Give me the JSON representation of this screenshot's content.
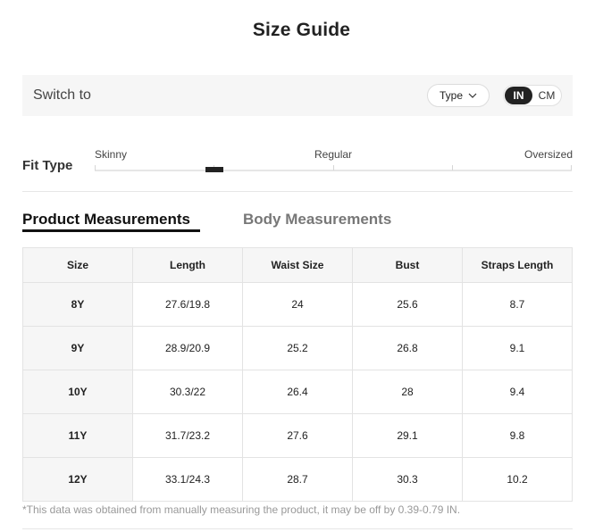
{
  "page": {
    "title": "Size Guide"
  },
  "switch_bar": {
    "label": "Switch to",
    "type_button": "Type",
    "units": {
      "active": "IN",
      "inactive": "CM"
    }
  },
  "fit_type": {
    "label": "Fit Type",
    "options": [
      "Skinny",
      "Regular",
      "Oversized"
    ],
    "selected_position": 0.25
  },
  "tabs": {
    "active": "Product Measurements",
    "inactive": "Body Measurements"
  },
  "table": {
    "headers": [
      "Size",
      "Length",
      "Waist Size",
      "Bust",
      "Straps Length"
    ],
    "rows": [
      [
        "8Y",
        "27.6/19.8",
        "24",
        "25.6",
        "8.7"
      ],
      [
        "9Y",
        "28.9/20.9",
        "25.2",
        "26.8",
        "9.1"
      ],
      [
        "10Y",
        "30.3/22",
        "26.4",
        "28",
        "9.4"
      ],
      [
        "11Y",
        "31.7/23.2",
        "27.6",
        "29.1",
        "9.8"
      ],
      [
        "12Y",
        "33.1/24.3",
        "28.7",
        "30.3",
        "10.2"
      ]
    ]
  },
  "footnote": "*This data was obtained from manually measuring the product, it may be off by 0.39-0.79 IN."
}
